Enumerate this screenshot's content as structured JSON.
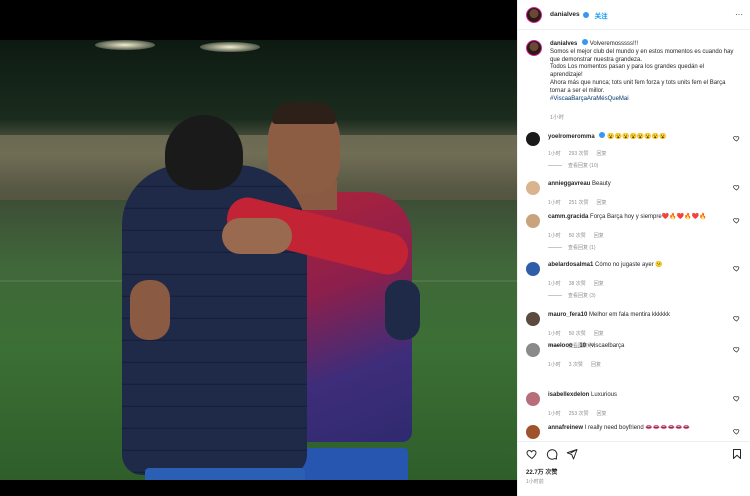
{
  "header": {
    "username": "danialves",
    "follow_label": "关注",
    "more_label": "···"
  },
  "caption": {
    "username": "danialves",
    "lines": [
      "Volveremosssss!!!",
      "Somos el mejor club del mundo y en estos momentos es cuando hay que demonstrar nuestra grandeza.",
      "Todos Los momentos pasan y para los grandes quedán el aprendizaje!",
      "Ahora más que nunca; tots unit fem forza y tots units fem el Barça tornar a ser el millor."
    ],
    "hashtag": "#ViscaaBarçaAraMésQueMai",
    "time": "1小时"
  },
  "comments": [
    {
      "user": "yoelromeromma",
      "verified": true,
      "text": "😮😮😮😮😮😮😮😮",
      "time": "1小时",
      "likes": "293 次赞",
      "reply": "回复",
      "view_replies": "查看回复 (10)",
      "avatar_color": "#1a1a1a"
    },
    {
      "user": "annieggavreau",
      "verified": false,
      "text": "Beauty",
      "time": "1小时",
      "likes": "251 次赞",
      "reply": "回复",
      "view_replies": "",
      "avatar_color": "#d9b48f"
    },
    {
      "user": "camm.gracida",
      "verified": false,
      "text": "Força Barça hoy y siempre❤️🔥❤️🔥❤️🔥",
      "time": "1小时",
      "likes": "50 次赞",
      "reply": "回复",
      "view_replies": "查看回复 (1)",
      "avatar_color": "#c9a27e"
    },
    {
      "user": "abelardosalma1",
      "verified": false,
      "text": "Cómo no jugaste ayer 😕",
      "time": "1小时",
      "likes": "38 次赞",
      "reply": "回复",
      "view_replies": "查看回复 (3)",
      "avatar_color": "#2f5ea8"
    },
    {
      "user": "mauro_fera10",
      "verified": false,
      "text": "Melhor em fala mentira kkkkkk",
      "time": "1小时",
      "likes": "50 次赞",
      "reply": "回复",
      "view_replies": "查看回复 (4)",
      "avatar_color": "#5b4a3d"
    },
    {
      "user": "maelooo__10",
      "verified": false,
      "text": "#viscaelbarça",
      "time": "1小时",
      "likes": "3 次赞",
      "reply": "回复",
      "view_replies": "",
      "avatar_color": "#8a8a8a"
    },
    {
      "user": "isabellexdelon",
      "verified": false,
      "text": "Luxurious",
      "time": "1小时",
      "likes": "253 次赞",
      "reply": "回复",
      "view_replies": "",
      "avatar_color": "#b76e79"
    },
    {
      "user": "annafreinew",
      "verified": false,
      "text": "I really need boyfriend 👄👄👄👄👄👄",
      "time": "",
      "likes": "",
      "reply": "",
      "view_replies": "",
      "avatar_color": "#a0522d"
    }
  ],
  "actions": {
    "likes": "22.7万 次赞",
    "post_time": "1小时前"
  },
  "colors": {
    "accent": "#0095f6",
    "hashtag": "#00376b",
    "muted": "#8e8e8e"
  }
}
